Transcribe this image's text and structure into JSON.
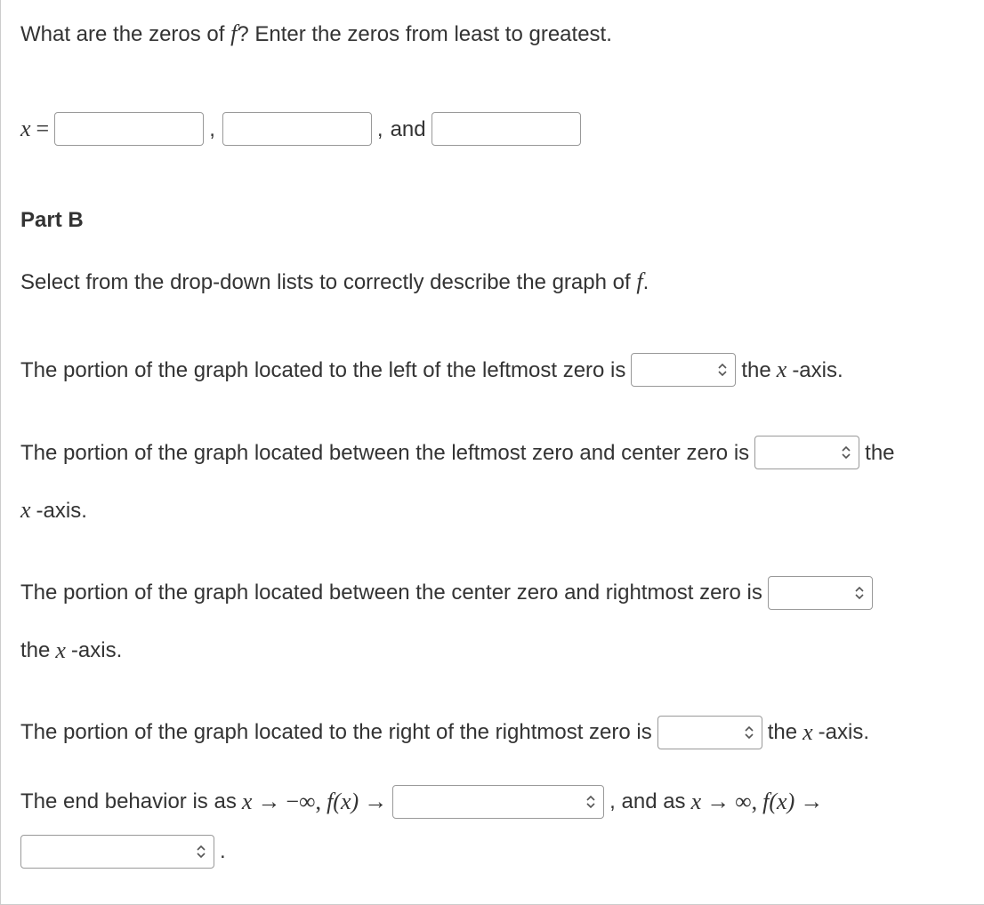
{
  "question": {
    "prompt_a": "What are the zeros of ",
    "prompt_b": "?  Enter the zeros from least to greatest.",
    "f": "f"
  },
  "zeros": {
    "x_eq": "x",
    "eq": " = ",
    "comma": ",",
    "and": " and ",
    "v1": "",
    "v2": "",
    "v3": ""
  },
  "partB": {
    "heading": "Part B",
    "instruction_a": "Select from the drop-down lists to correctly describe the graph of ",
    "instruction_b": ".",
    "s1a": "The portion of the graph located to the left of the leftmost zero is ",
    "s1b": " the ",
    "s1c": "x",
    "s1d": "-axis.",
    "s2a": "The portion of the graph located between the leftmost zero and center zero is ",
    "s2b": " the",
    "s2c": "x",
    "s2d": "-axis.",
    "s3a": "The portion of the graph located between the center zero and rightmost zero is ",
    "s3b": "the ",
    "s3c": "x",
    "s3d": "-axis.",
    "s4a": "The portion of the graph located to the right of the rightmost zero is ",
    "s4b": " the ",
    "s4c": "x",
    "s4d": "-axis.",
    "end_a": "The end behavior is as ",
    "end_x1": "x",
    "end_arrow": " → ",
    "end_neginf": "−∞, ",
    "end_fx": "f(x)",
    "end_arrow2": " → ",
    "end_comma_and": ", and as ",
    "end_x2": "x",
    "end_posinf": "∞, ",
    "end_period": ".",
    "dd1": "",
    "dd2": "",
    "dd3": "",
    "dd4": "",
    "dd5": "",
    "dd6": ""
  }
}
